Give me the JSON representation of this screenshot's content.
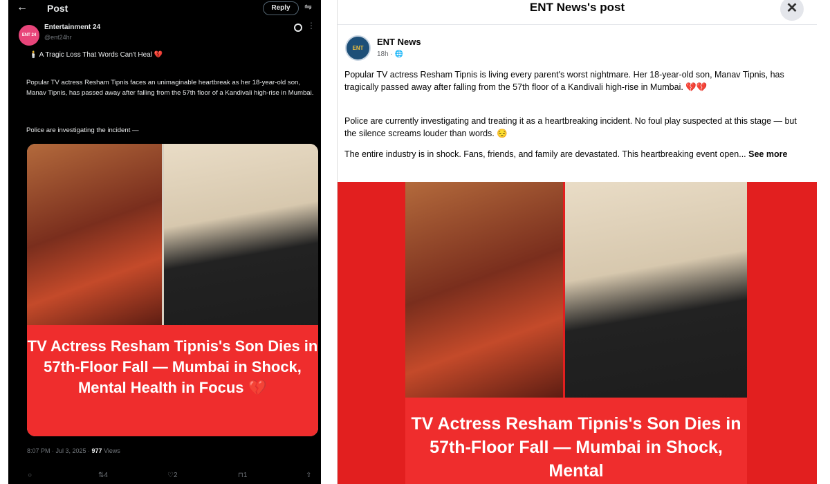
{
  "x_post": {
    "back_icon": "arrow-left-icon",
    "title": "Post",
    "reply_label": "Reply",
    "author_name": "Entertainment 24",
    "author_handle": "@ent24hr",
    "avatar_text": "ENT 24",
    "headline": "🕯️ A Tragic Loss That Words Can't Heal 💔",
    "body": "Popular TV actress Resham Tipnis faces an unimaginable heartbreak as her 18-year-old son, Manav Tipnis, has passed away after falling from the 57th floor of a Kandivali high-rise in Mumbai.",
    "police": "Police are investigating the incident —",
    "image_text": "TV Actress Resham Tipnis's Son Dies in 57th-Floor Fall — Mumbai in Shock, Mental Health in Focus 💔",
    "timestamp": "8:07 PM · Jul 3, 2025 · ",
    "views_count": "977",
    "views_label": " Views",
    "retweets": "4",
    "likes": "2",
    "bookmarks": "1"
  },
  "fb_post": {
    "header_title": "ENT News's post",
    "close_icon": "close-icon",
    "page_name": "ENT News",
    "avatar_text": "ENT",
    "time": "18h · 🌐",
    "paragraph1": "Popular TV actress Resham Tipnis is living every parent's worst nightmare. Her 18-year-old son, Manav Tipnis, has tragically passed away after falling from the 57th floor of a Kandivali high-rise in Mumbai. 💔💔",
    "paragraph2": "Police are currently investigating and treating it as a heartbreaking incident. No foul play suspected at this stage — but the silence screams louder than words. 😔",
    "paragraph3": "The entire industry is in shock. Fans, friends, and family are devastated. This heartbreaking event open...",
    "see_more": "See more",
    "image_text": "TV Actress Resham Tipnis's Son Dies in 57th-Floor Fall — Mumbai in Shock, Mental"
  }
}
